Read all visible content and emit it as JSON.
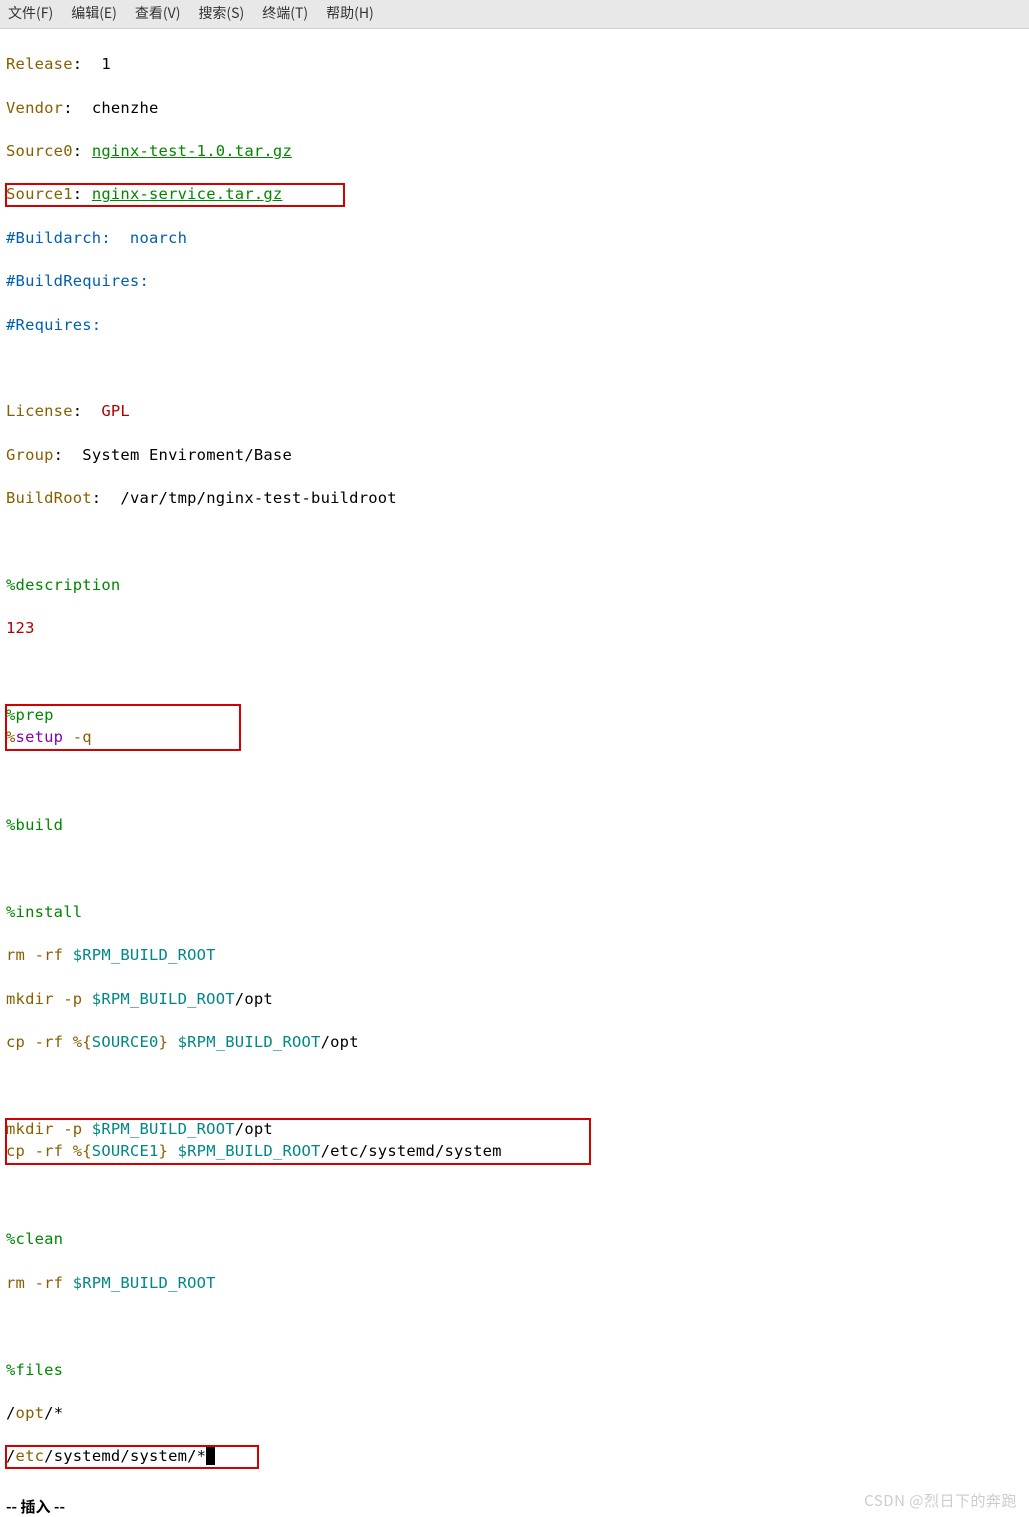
{
  "menu": {
    "file": "文件(F)",
    "edit": "编辑(E)",
    "view": "查看(V)",
    "search": "搜索(S)",
    "terminal": "终端(T)",
    "help": "帮助(H)"
  },
  "spec": {
    "release_k": "Release",
    "release_v": "1",
    "vendor_k": "Vendor",
    "vendor_v": "chenzhe",
    "source0_k": "Source0",
    "source0_v": "nginx-test-1.0.tar.gz",
    "source1_k": "Source1",
    "source1_v": "nginx-service.tar.gz",
    "buildarch": "#Buildarch:  noarch",
    "buildrequires": "#BuildRequires:",
    "requires": "#Requires:",
    "license_k": "License",
    "license_v": "GPL",
    "group_k": "Group",
    "group_v": "System Enviroment/Base",
    "buildroot_k": "BuildRoot",
    "buildroot_v": "/var/tmp/nginx-test-buildroot",
    "description": "%description",
    "description_body": "123",
    "prep": "%prep",
    "setup_pct": "%",
    "setup_cmd": "setup",
    "setup_flag": " -q",
    "build": "%build",
    "install": "%install",
    "rm1_a": "rm -rf ",
    "rm1_b": "$RPM_BUILD_ROOT",
    "mkdir1_a": "mkdir -p ",
    "mkdir1_b": "$RPM_BUILD_ROOT",
    "mkdir1_c": "/opt",
    "cp1_a": "cp -rf %{",
    "cp1_b": "SOURCE0",
    "cp1_c": "} ",
    "cp1_d": "$RPM_BUILD_ROOT",
    "cp1_e": "/opt",
    "mkdir2_a": "mkdir -p ",
    "mkdir2_b": "$RPM_BUILD_ROOT",
    "mkdir2_c": "/opt",
    "cp2_a": "cp -rf %{",
    "cp2_b": "SOURCE1",
    "cp2_c": "} ",
    "cp2_d": "$RPM_BUILD_ROOT",
    "cp2_e": "/etc/systemd/system",
    "clean": "%clean",
    "rm2_a": "rm -rf ",
    "rm2_b": "$RPM_BUILD_ROOT",
    "files": "%files",
    "files_opt_a": "/",
    "files_opt_b": "opt",
    "files_opt_c": "/*",
    "files_etc_a": "/",
    "files_etc_b": "etc",
    "files_etc_c": "/systemd/system/*"
  },
  "status": "-- 插入 --",
  "watermark": "CSDN @烈日下的奔跑"
}
